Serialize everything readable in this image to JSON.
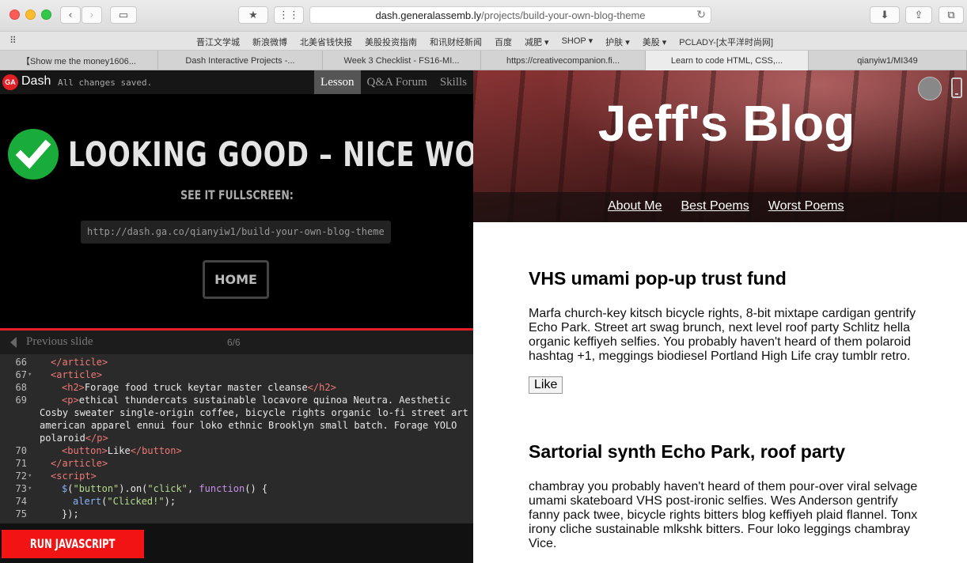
{
  "browser": {
    "url_host": "dash.generalassemb.ly",
    "url_path": "/projects/build-your-own-blog-theme",
    "bookmarks": [
      "晋江文学城",
      "新浪微博",
      "北美省钱快报",
      "美股投资指南",
      "和讯财经新闻",
      "百度",
      "减肥 ▾",
      "SHOP ▾",
      "护肤 ▾",
      "美股 ▾",
      "PCLADY-[太平洋时尚网]"
    ],
    "tabs": [
      {
        "label": "【Show me the money1606..."
      },
      {
        "label": "Dash Interactive Projects -..."
      },
      {
        "label": "Week 3 Checklist - FS16-MI..."
      },
      {
        "label": "https://creativecompanion.fi..."
      },
      {
        "label": "Learn to code HTML, CSS,..."
      },
      {
        "label": "qianyiw1/MI349"
      }
    ],
    "active_tab": 4
  },
  "dash": {
    "logo": "GA",
    "title": "Dash",
    "status": "All changes saved.",
    "nav": [
      "Lesson",
      "Q&A Forum",
      "Skills"
    ],
    "success_heading": "LOOKING GOOD – NICE WORK!",
    "fullscreen_label": "SEE IT FULLSCREEN:",
    "fullscreen_url": "http://dash.ga.co/qianyiw1/build-your-own-blog-theme",
    "home_label": "HOME",
    "prev_label": "Previous slide",
    "slide_count": "6/6",
    "run_label": "RUN JAVASCRIPT"
  },
  "code_lines": [
    {
      "n": "66",
      "fold": "",
      "html": "<span class='tag'>&lt;/article&gt;</span>",
      "indent": 1
    },
    {
      "n": "67",
      "fold": "▾",
      "html": "<span class='tag'>&lt;article&gt;</span>",
      "indent": 1
    },
    {
      "n": "68",
      "fold": "",
      "html": "<span class='tag'>&lt;h2&gt;</span>Forage food truck keytar master cleanse<span class='tag'>&lt;/h2&gt;</span>",
      "indent": 2
    },
    {
      "n": "69",
      "fold": "",
      "html": "<span class='tag'>&lt;p&gt;</span>ethical thundercats sustainable locavore quinoa Neutra. Aesthetic",
      "indent": 2
    },
    {
      "n": "",
      "fold": "",
      "html": "Cosby sweater single-origin coffee, bicycle rights organic lo-fi street art",
      "indent": 0
    },
    {
      "n": "",
      "fold": "",
      "html": "american apparel ennui four loko ethnic Brooklyn small batch. Forage YOLO",
      "indent": 0
    },
    {
      "n": "",
      "fold": "",
      "html": "polaroid<span class='tag'>&lt;/p&gt;</span>",
      "indent": 0
    },
    {
      "n": "70",
      "fold": "",
      "html": "<span class='tag'>&lt;button&gt;</span>Like<span class='tag'>&lt;/button&gt;</span>",
      "indent": 2
    },
    {
      "n": "71",
      "fold": "",
      "html": "<span class='tag'>&lt;/article&gt;</span>",
      "indent": 1
    },
    {
      "n": "72",
      "fold": "▾",
      "html": "<span class='tag'>&lt;script&gt;</span>",
      "indent": 1
    },
    {
      "n": "73",
      "fold": "▾",
      "html": "<span class='fn'>$</span>(<span class='str'>\"button\"</span>).on(<span class='str'>\"click\"</span>, <span class='kw'>function</span>() {",
      "indent": 2
    },
    {
      "n": "74",
      "fold": "",
      "html": "<span class='fn'>alert</span>(<span class='str'>\"Clicked!\"</span>);",
      "indent": 3
    },
    {
      "n": "75",
      "fold": "",
      "html": "});",
      "indent": 2
    }
  ],
  "blog": {
    "title": "Jeff's Blog",
    "nav": [
      "About Me",
      "Best Poems",
      "Worst Poems"
    ],
    "posts": [
      {
        "title": "VHS umami pop-up trust fund",
        "body": "Marfa church-key kitsch bicycle rights, 8-bit mixtape cardigan gentrify Echo Park. Street art swag brunch, next level roof party Schlitz hella organic keffiyeh selfies. You probably haven't heard of them polaroid hashtag +1, meggings biodiesel Portland High Life cray tumblr retro.",
        "button": "Like"
      },
      {
        "title": "Sartorial synth Echo Park, roof party",
        "body": "chambray you probably haven't heard of them pour-over viral selvage umami skateboard VHS post-ironic selfies. Wes Anderson gentrify fanny pack twee, bicycle rights bitters blog keffiyeh plaid flannel. Tonx irony cliche sustainable mlkshk bitters. Four loko leggings chambray Vice."
      }
    ]
  },
  "colors": {
    "ga_red": "#e21f26",
    "success_green": "#1aac3a",
    "run_red": "#f21414"
  }
}
